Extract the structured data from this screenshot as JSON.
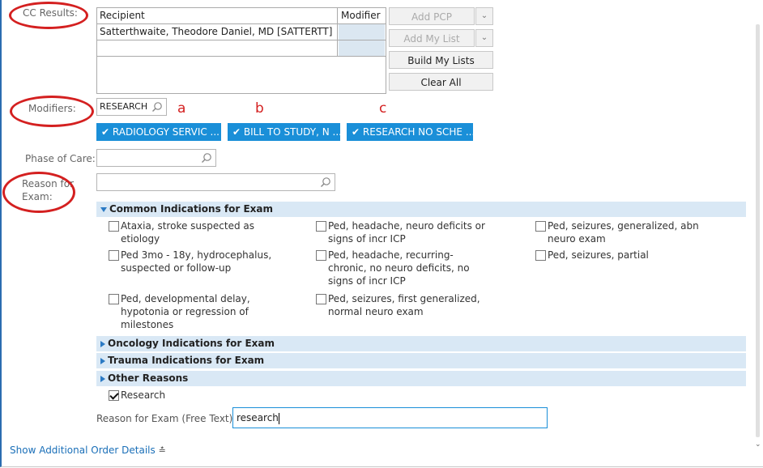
{
  "labels": {
    "cc_results": "CC Results:",
    "modifiers": "Modifiers:",
    "phase_of_care": "Phase of Care:",
    "reason_for_exam_line1": "Reason for",
    "reason_for_exam_line2": "Exam:",
    "free_text": "Reason for Exam (Free Text):"
  },
  "cc_table": {
    "headers": [
      "Recipient",
      "Modifier"
    ],
    "rows": [
      {
        "recipient": "Satterthwaite, Theodore Daniel, MD [SATTERTT]",
        "modifier": ""
      }
    ]
  },
  "buttons": {
    "add_pcp": "Add PCP",
    "add_my_list": "Add My List",
    "build_my_lists": "Build My Lists",
    "clear_all": "Clear All"
  },
  "modifiers": {
    "value": "RESEARCH",
    "annotations": [
      "a",
      "b",
      "c"
    ],
    "chips": [
      "RADIOLOGY SERVIC ...",
      "BILL TO STUDY, N ...",
      "RESEARCH NO SCHE ..."
    ]
  },
  "phase_of_care": {
    "value": ""
  },
  "reason_for_exam": {
    "value": ""
  },
  "sections": {
    "common": "Common Indications for Exam",
    "oncology": "Oncology Indications for Exam",
    "trauma": "Trauma Indications for Exam",
    "other": "Other Reasons"
  },
  "common_options": [
    {
      "text": "Ataxia, stroke suspected as etiology",
      "checked": false
    },
    {
      "text": "Ped, headache, neuro deficits or signs of incr ICP",
      "checked": false
    },
    {
      "text": "Ped, seizures, generalized, abn neuro exam",
      "checked": false
    },
    {
      "text": "Ped 3mo - 18y, hydrocephalus, suspected or follow-up",
      "checked": false
    },
    {
      "text": "Ped, headache, recurring-chronic, no neuro deficits, no signs of incr ICP",
      "checked": false
    },
    {
      "text": "Ped, seizures, partial",
      "checked": false
    },
    {
      "text": "Ped, developmental delay, hypotonia or regression of milestones",
      "checked": false
    },
    {
      "text": "Ped, seizures, first generalized, normal neuro exam",
      "checked": false
    }
  ],
  "other_options": [
    {
      "text": "Research",
      "checked": true
    }
  ],
  "free_text": {
    "value": "research"
  },
  "footer": {
    "show_details": "Show Additional Order Details"
  }
}
